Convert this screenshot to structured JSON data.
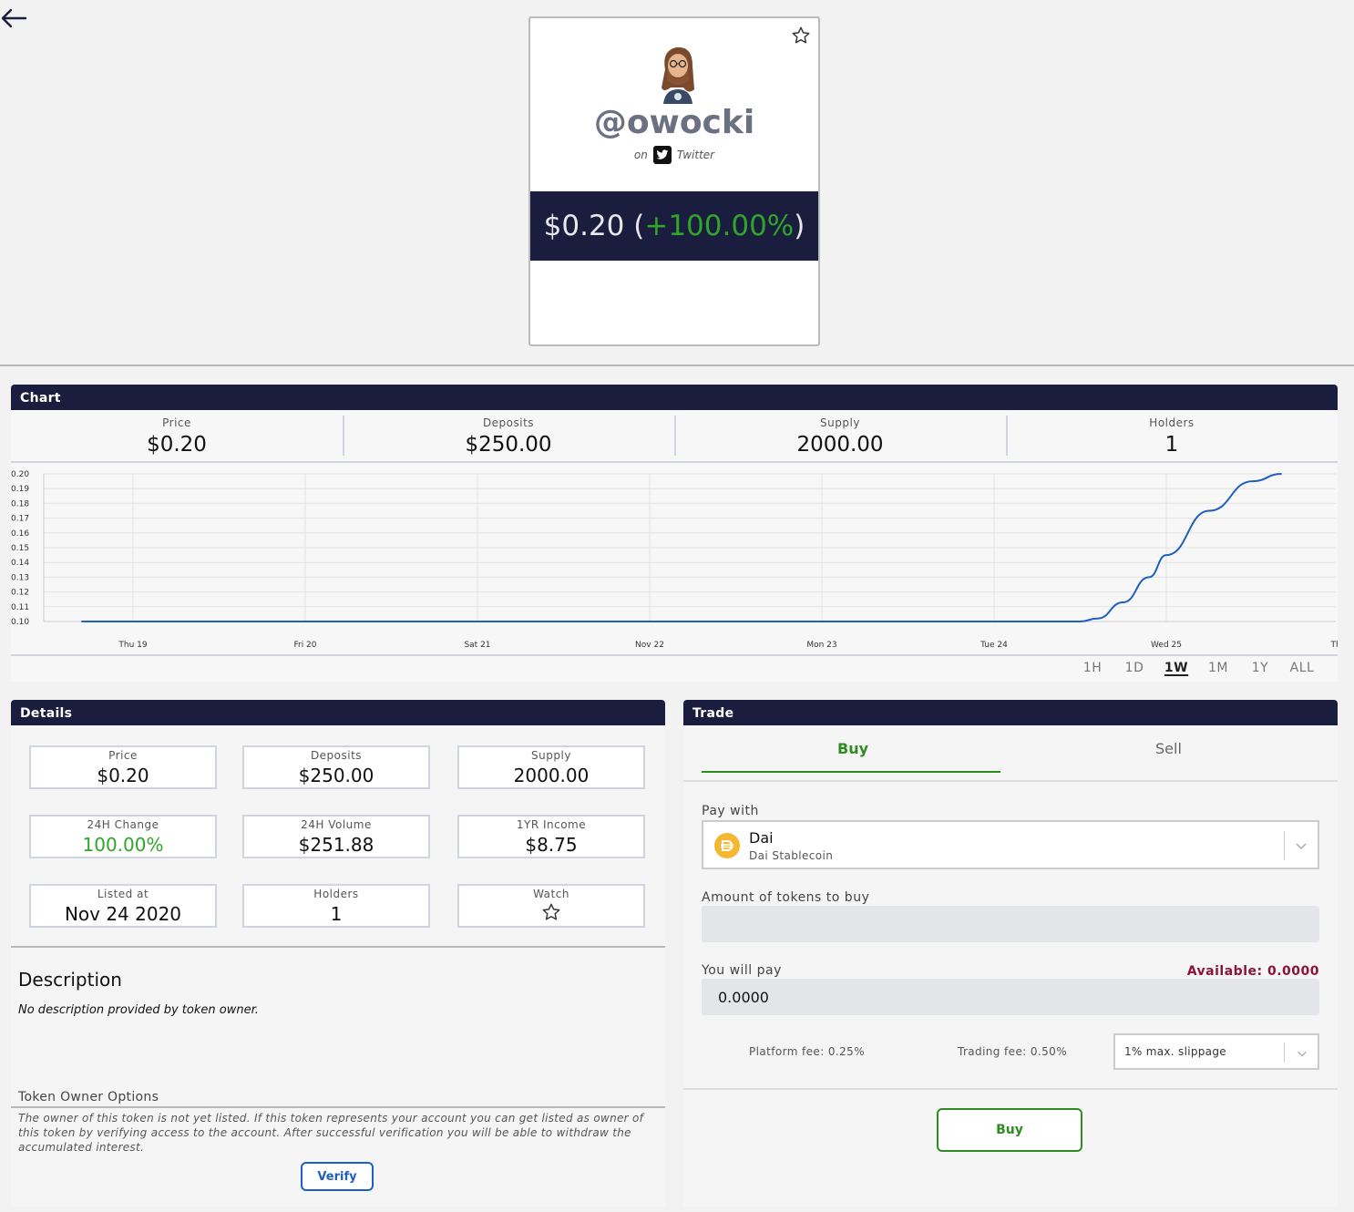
{
  "card": {
    "handle": "@owocki",
    "on_label": "on",
    "platform": "Twitter",
    "price": "$0.20",
    "change": "+100.00%"
  },
  "chart_panel": {
    "title": "Chart",
    "stats": [
      {
        "label": "Price",
        "value": "$0.20"
      },
      {
        "label": "Deposits",
        "value": "$250.00"
      },
      {
        "label": "Supply",
        "value": "2000.00"
      },
      {
        "label": "Holders",
        "value": "1"
      }
    ],
    "ranges": [
      "1H",
      "1D",
      "1W",
      "1M",
      "1Y",
      "ALL"
    ],
    "active_range": "1W"
  },
  "chart_data": {
    "type": "line",
    "x_ticks": [
      "Thu 19",
      "Fri 20",
      "Sat 21",
      "Nov 22",
      "Mon 23",
      "Tue 24",
      "Wed 25",
      "Thu"
    ],
    "y_ticks": [
      "0.20",
      "0.19",
      "0.18",
      "0.17",
      "0.16",
      "0.15",
      "0.14",
      "0.13",
      "0.12",
      "0.11",
      "0.10"
    ],
    "ylim": [
      0.1,
      0.2
    ],
    "grid": true,
    "color": "#1f5fbf",
    "series": [
      {
        "x": [
          "Thu 19 -0.3",
          "Tue 24 +0.5",
          "Tue 24 +0.6",
          "Tue 24 +0.75",
          "Tue 24 +0.9",
          "Wed 25",
          "Wed 25 +0.25",
          "Wed 25 +0.5",
          "Wed 25 +0.7"
        ],
        "x_days": [
          -0.3,
          5.5,
          5.6,
          5.75,
          5.9,
          6.0,
          6.25,
          6.5,
          6.67
        ],
        "values": [
          0.1,
          0.1,
          0.102,
          0.113,
          0.13,
          0.145,
          0.175,
          0.195,
          0.2
        ]
      }
    ]
  },
  "details": {
    "title": "Details",
    "tiles": [
      {
        "label": "Price",
        "value": "$0.20"
      },
      {
        "label": "Deposits",
        "value": "$250.00"
      },
      {
        "label": "Supply",
        "value": "2000.00"
      },
      {
        "label": "24H Change",
        "value": "100.00%"
      },
      {
        "label": "24H Volume",
        "value": "$251.88"
      },
      {
        "label": "1YR Income",
        "value": "$8.75"
      },
      {
        "label": "Listed at",
        "value": "Nov 24 2020"
      },
      {
        "label": "Holders",
        "value": "1"
      },
      {
        "label": "Watch",
        "value": ""
      }
    ],
    "description_title": "Description",
    "description_text": "No description provided by token owner.",
    "owner_title": "Token Owner Options",
    "owner_text": "The owner of this token is not yet listed. If this token represents your account you can get listed as owner of this token by verifying access to the account. After successful verification you will be able to withdraw the accumulated interest.",
    "verify_label": "Verify"
  },
  "trade": {
    "title": "Trade",
    "tab_buy": "Buy",
    "tab_sell": "Sell",
    "pay_with_label": "Pay with",
    "currency_name": "Dai",
    "currency_sub": "Dai Stablecoin",
    "amount_label": "Amount of tokens to buy",
    "amount_value": "",
    "you_pay_label": "You will pay",
    "available": "Available: 0.0000",
    "pay_value": "0.0000",
    "platform_fee": "Platform fee: 0.25%",
    "trading_fee": "Trading fee: 0.50%",
    "slippage": "1% max. slippage",
    "buy_button": "Buy"
  },
  "colors": {
    "navy": "#1a1d3d",
    "green": "#2f8a22",
    "positive": "#2fa52a",
    "available": "#8a1538",
    "line": "#1f5fbf"
  }
}
